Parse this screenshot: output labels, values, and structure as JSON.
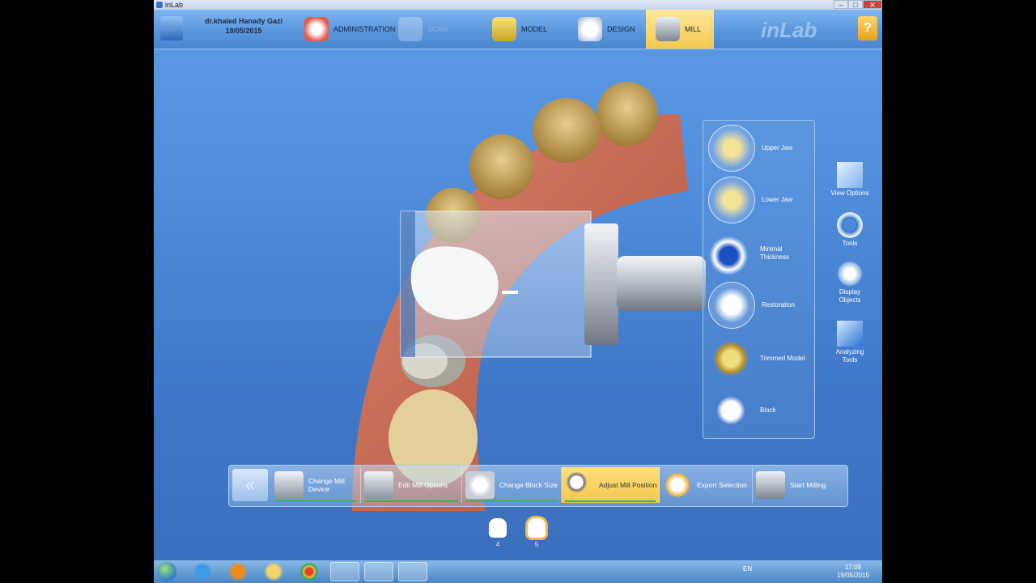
{
  "window": {
    "title": "inLab",
    "min": "–",
    "max": "□",
    "close": "✕"
  },
  "patient": {
    "name": "dr.khaled Hanady Gazi",
    "date": "19/05/2015"
  },
  "stages": [
    {
      "label": "ADMINISTRATION",
      "state": "done"
    },
    {
      "label": "SCAN",
      "state": "disabled"
    },
    {
      "label": "MODEL",
      "state": "done"
    },
    {
      "label": "DESIGN",
      "state": "done"
    },
    {
      "label": "MILL",
      "state": "active"
    }
  ],
  "brand": {
    "logo": "inLab",
    "help": "?"
  },
  "object_panel": [
    {
      "label": "Upper Jaw",
      "icon": "upper-jaw-icon"
    },
    {
      "label": "Lower Jaw",
      "icon": "lower-jaw-icon"
    },
    {
      "label": "Minimal Thickness",
      "icon": "minimal-thickness-icon"
    },
    {
      "label": "Restoration",
      "icon": "restoration-icon"
    },
    {
      "label": "Trimmed Model",
      "icon": "trimmed-model-icon"
    },
    {
      "label": "Block",
      "icon": "block-icon"
    }
  ],
  "right_tools": [
    {
      "label": "View Options",
      "icon": "cube-icon"
    },
    {
      "label": "Tools",
      "icon": "tools-ring-icon"
    },
    {
      "label": "Display Objects",
      "icon": "display-objects-icon"
    },
    {
      "label": "Analyzing Tools",
      "icon": "analyzing-tools-icon"
    }
  ],
  "bottom_bar": {
    "back": "«",
    "buttons": [
      {
        "label": "Change Mill Device",
        "done": true
      },
      {
        "label": "Edit Mill Options",
        "done": true
      },
      {
        "label": "Change Block Size",
        "done": true
      },
      {
        "label": "Adjust Mill Position",
        "done": true,
        "active": true
      },
      {
        "label": "Export Selection",
        "done": false
      },
      {
        "label": "Start Milling",
        "done": false
      }
    ]
  },
  "teeth": [
    {
      "number": "4",
      "active": false
    },
    {
      "number": "5",
      "active": true
    }
  ],
  "taskbar": {
    "lang": "EN",
    "time": "17:09",
    "date": "19/05/2015"
  },
  "colors": {
    "accent": "#f2c94f",
    "background": "#4f8cda",
    "progress": "#3db54a"
  }
}
